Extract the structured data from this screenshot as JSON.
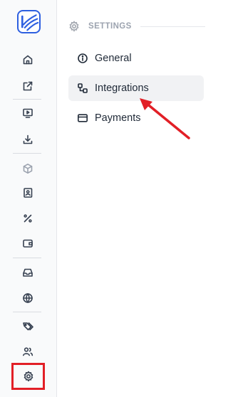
{
  "sidebar": {
    "logo_icon": "brand-logo-icon",
    "groups": [
      [
        {
          "icon": "home-icon"
        },
        {
          "icon": "external-link-icon"
        }
      ],
      [
        {
          "icon": "monitor-play-icon"
        },
        {
          "icon": "download-icon"
        }
      ],
      [
        {
          "icon": "box-icon"
        },
        {
          "icon": "contact-book-icon"
        },
        {
          "icon": "percent-icon"
        },
        {
          "icon": "wallet-icon"
        }
      ],
      [
        {
          "icon": "inbox-icon"
        },
        {
          "icon": "globe-icon"
        }
      ],
      [
        {
          "icon": "tags-icon"
        },
        {
          "icon": "users-icon"
        },
        {
          "icon": "settings-gear-icon",
          "active": true
        }
      ]
    ]
  },
  "settings": {
    "section_title": "SETTINGS",
    "menu": [
      {
        "label": "General",
        "icon": "info-circle-icon",
        "active": false
      },
      {
        "label": "Integrations",
        "icon": "integrations-icon",
        "active": true
      },
      {
        "label": "Payments",
        "icon": "credit-card-icon",
        "active": false
      }
    ]
  },
  "annotations": {
    "highlight_color": "#e21f26",
    "arrow_color": "#e21f26"
  },
  "colors": {
    "brand": "#2d5fe0",
    "active_bg": "#f1f2f4"
  }
}
